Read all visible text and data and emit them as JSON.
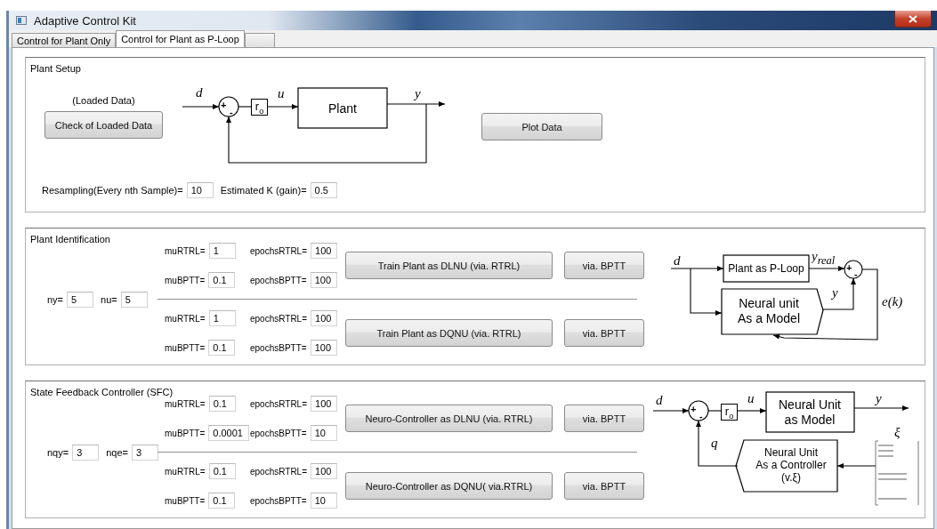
{
  "window": {
    "title": "Adaptive Control Kit"
  },
  "tabs": [
    {
      "label": "Control for Plant Only",
      "selected": false
    },
    {
      "label": "Control for Plant as P-Loop",
      "selected": true
    },
    {
      "selected": false
    }
  ],
  "plant_setup": {
    "title": "Plant Setup",
    "loaded_label": "(Loaded Data)",
    "check_button": "Check of Loaded Data",
    "plot_button": "Plot Data",
    "diagram": {
      "input": "d",
      "plus": "+",
      "minus": "-",
      "gain": "r$_{o}$",
      "control": "u",
      "block": "Plant",
      "output": "y"
    },
    "fields": [
      {
        "label": "Resampling(Every nth Sample)=",
        "value": "10"
      },
      {
        "label": "Estimated K (gain)=",
        "value": "0.5"
      }
    ]
  },
  "plant_identification": {
    "title": "Plant Identification",
    "orders": [
      {
        "label": "ny=",
        "value": "5"
      },
      {
        "label": "nu=",
        "value": "5"
      }
    ],
    "models": [
      {
        "rows": [
          [
            {
              "label": "muRTRL=",
              "value": "1"
            },
            {
              "label": "epochsRTRL=",
              "value": "100"
            }
          ],
          [
            {
              "label": "muBPTT=",
              "value": "0.1"
            },
            {
              "label": "epochsBPTT=",
              "value": "100"
            }
          ]
        ],
        "train_button": "Train Plant as DLNU (via. RTRL)",
        "bptt_button": "via. BPTT"
      },
      {
        "rows": [
          [
            {
              "label": "muRTRL=",
              "value": "1"
            },
            {
              "label": "epochsRTRL=",
              "value": "100"
            }
          ],
          [
            {
              "label": "muBPTT=",
              "value": "0.1"
            },
            {
              "label": "epochsBPTT=",
              "value": "100"
            }
          ]
        ],
        "train_button": "Train Plant as DQNU (via. RTRL)",
        "bptt_button": "via. BPTT"
      }
    ],
    "diagram": {
      "input": "d",
      "plant_block": "Plant as P-Loop",
      "plant_output": "y$_{real}$",
      "plus": "+",
      "minus": "-",
      "model_block": [
        "Neural unit",
        "As a Model"
      ],
      "model_output": "y",
      "error": "e(k)"
    }
  },
  "sfc": {
    "title": "State Feedback Controller (SFC)",
    "orders": [
      {
        "label": "nqy=",
        "value": "3"
      },
      {
        "label": "nqe=",
        "value": "3"
      }
    ],
    "models": [
      {
        "rows": [
          [
            {
              "label": "muRTRL=",
              "value": "0.1"
            },
            {
              "label": "epochsRTRL=",
              "value": "100"
            }
          ],
          [
            {
              "label": "muBPTT=",
              "value": "0.0001"
            },
            {
              "label": "epochsBPTT=",
              "value": "10"
            }
          ]
        ],
        "train_button": "Neuro-Controller as DLNU (via. RTRL)",
        "bptt_button": "via. BPTT"
      },
      {
        "rows": [
          [
            {
              "label": "muRTRL=",
              "value": "0.1"
            },
            {
              "label": "epochsRTRL=",
              "value": "100"
            }
          ],
          [
            {
              "label": "muBPTT=",
              "value": "0.1"
            },
            {
              "label": "epochsBPTT=",
              "value": "10"
            }
          ]
        ],
        "train_button": "Neuro-Controller as DQNU( via.RTRL)",
        "bptt_button": "via. BPTT"
      }
    ],
    "diagram": {
      "input": "d",
      "plus": "+",
      "minus": "-",
      "gain": "r$_{o}$",
      "control": "u",
      "model_block": [
        "Neural Unit",
        "as Model"
      ],
      "output": "y",
      "state": "ξ",
      "controller_block": [
        "Neural Unit",
        "As a Controller",
        "(v.ξ)"
      ],
      "feedback": "q"
    }
  }
}
